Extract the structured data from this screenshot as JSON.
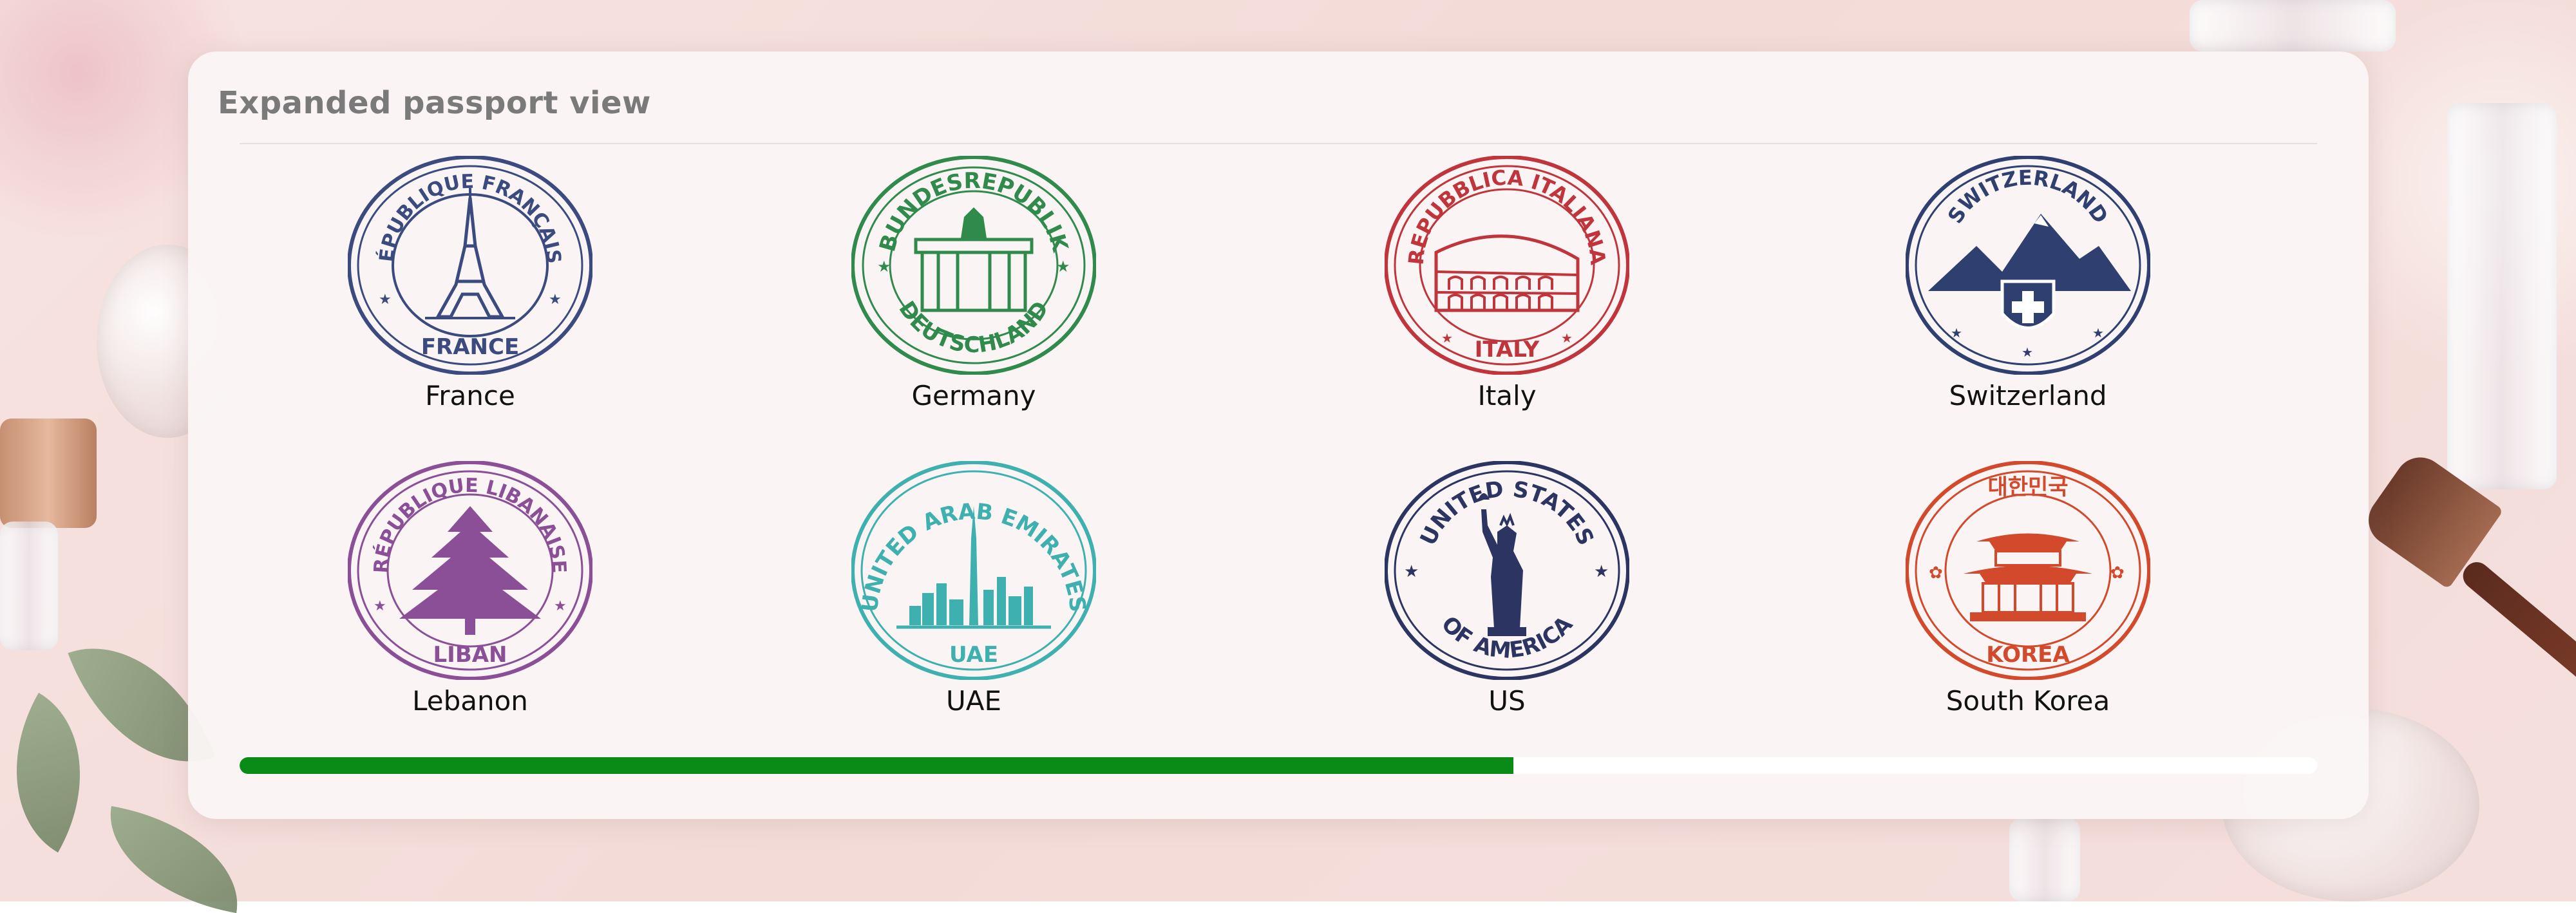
{
  "panel": {
    "title": "Expanded passport view"
  },
  "stamps": [
    {
      "label": "France",
      "top_text": "RÉPUBLIQUE FRANÇAISE",
      "bottom_text": "FRANCE",
      "color": "#3b4a7f",
      "icon": "eiffel-tower-icon"
    },
    {
      "label": "Germany",
      "top_text": "BUNDESREPUBLIK",
      "bottom_text": "DEUTSCHLAND",
      "color": "#2f8a4c",
      "icon": "brandenburg-gate-icon"
    },
    {
      "label": "Italy",
      "top_text": "REPUBBLICA ITALIANA",
      "bottom_text": "ITALY",
      "color": "#c0343b",
      "icon": "colosseum-icon"
    },
    {
      "label": "Switzerland",
      "top_text": "SWITZERLAND",
      "bottom_text": "",
      "color": "#2f3f70",
      "icon": "alps-swiss-cross-icon"
    },
    {
      "label": "Lebanon",
      "top_text": "RÉPUBLIQUE LIBANAISE",
      "bottom_text": "LIBAN",
      "color": "#8a4f96",
      "icon": "cedar-tree-icon"
    },
    {
      "label": "UAE",
      "top_text": "UNITED ARAB EMIRATES",
      "bottom_text": "UAE",
      "color": "#3fb0b0",
      "icon": "dubai-skyline-icon"
    },
    {
      "label": "US",
      "top_text": "UNITED STATES",
      "bottom_text": "OF AMERICA",
      "color": "#2c3462",
      "icon": "statue-of-liberty-icon"
    },
    {
      "label": "South Korea",
      "top_text": "대한민국",
      "bottom_text": "KOREA",
      "color": "#d2492b",
      "icon": "korean-palace-icon"
    }
  ],
  "progress": {
    "fraction": 0.613,
    "color": "#0a8a16"
  }
}
